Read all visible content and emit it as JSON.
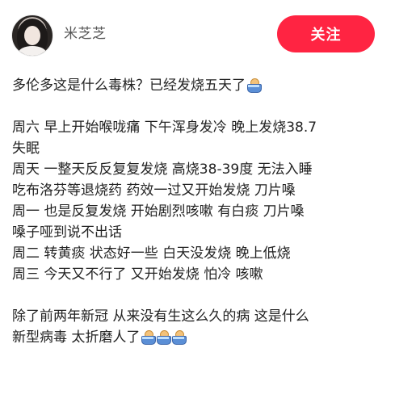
{
  "header": {
    "username": "米芝芝",
    "follow_label": "关注"
  },
  "post": {
    "lines": [
      "多伦多这是什么毒株？已经发烧五天了",
      "",
      "周六 早上开始喉咙痛 下午浑身发冷 晚上发烧38.7",
      "失眠",
      "周天 一整天反反复复发烧 高烧38-39度 无法入睡",
      "吃布洛芬等退烧药 药效一过又开始发烧 刀片嗓",
      "周一 也是反复发烧 开始剧烈咳嗽 有白痰 刀片嗓",
      "嗓子哑到说不出话",
      "周二 转黄痰 状态好一些 白天没发烧 晚上低烧",
      "周三 今天又不行了 又开始发烧 怕冷 咳嗽",
      "",
      "除了前两年新冠 从来没有生这么久的病 这是什么",
      "新型病毒 太折磨人了"
    ],
    "emoji_name": "bathtub-emoji-icon"
  },
  "colors": {
    "follow_button": "#ff2442",
    "text": "#222222",
    "username": "#555555"
  }
}
